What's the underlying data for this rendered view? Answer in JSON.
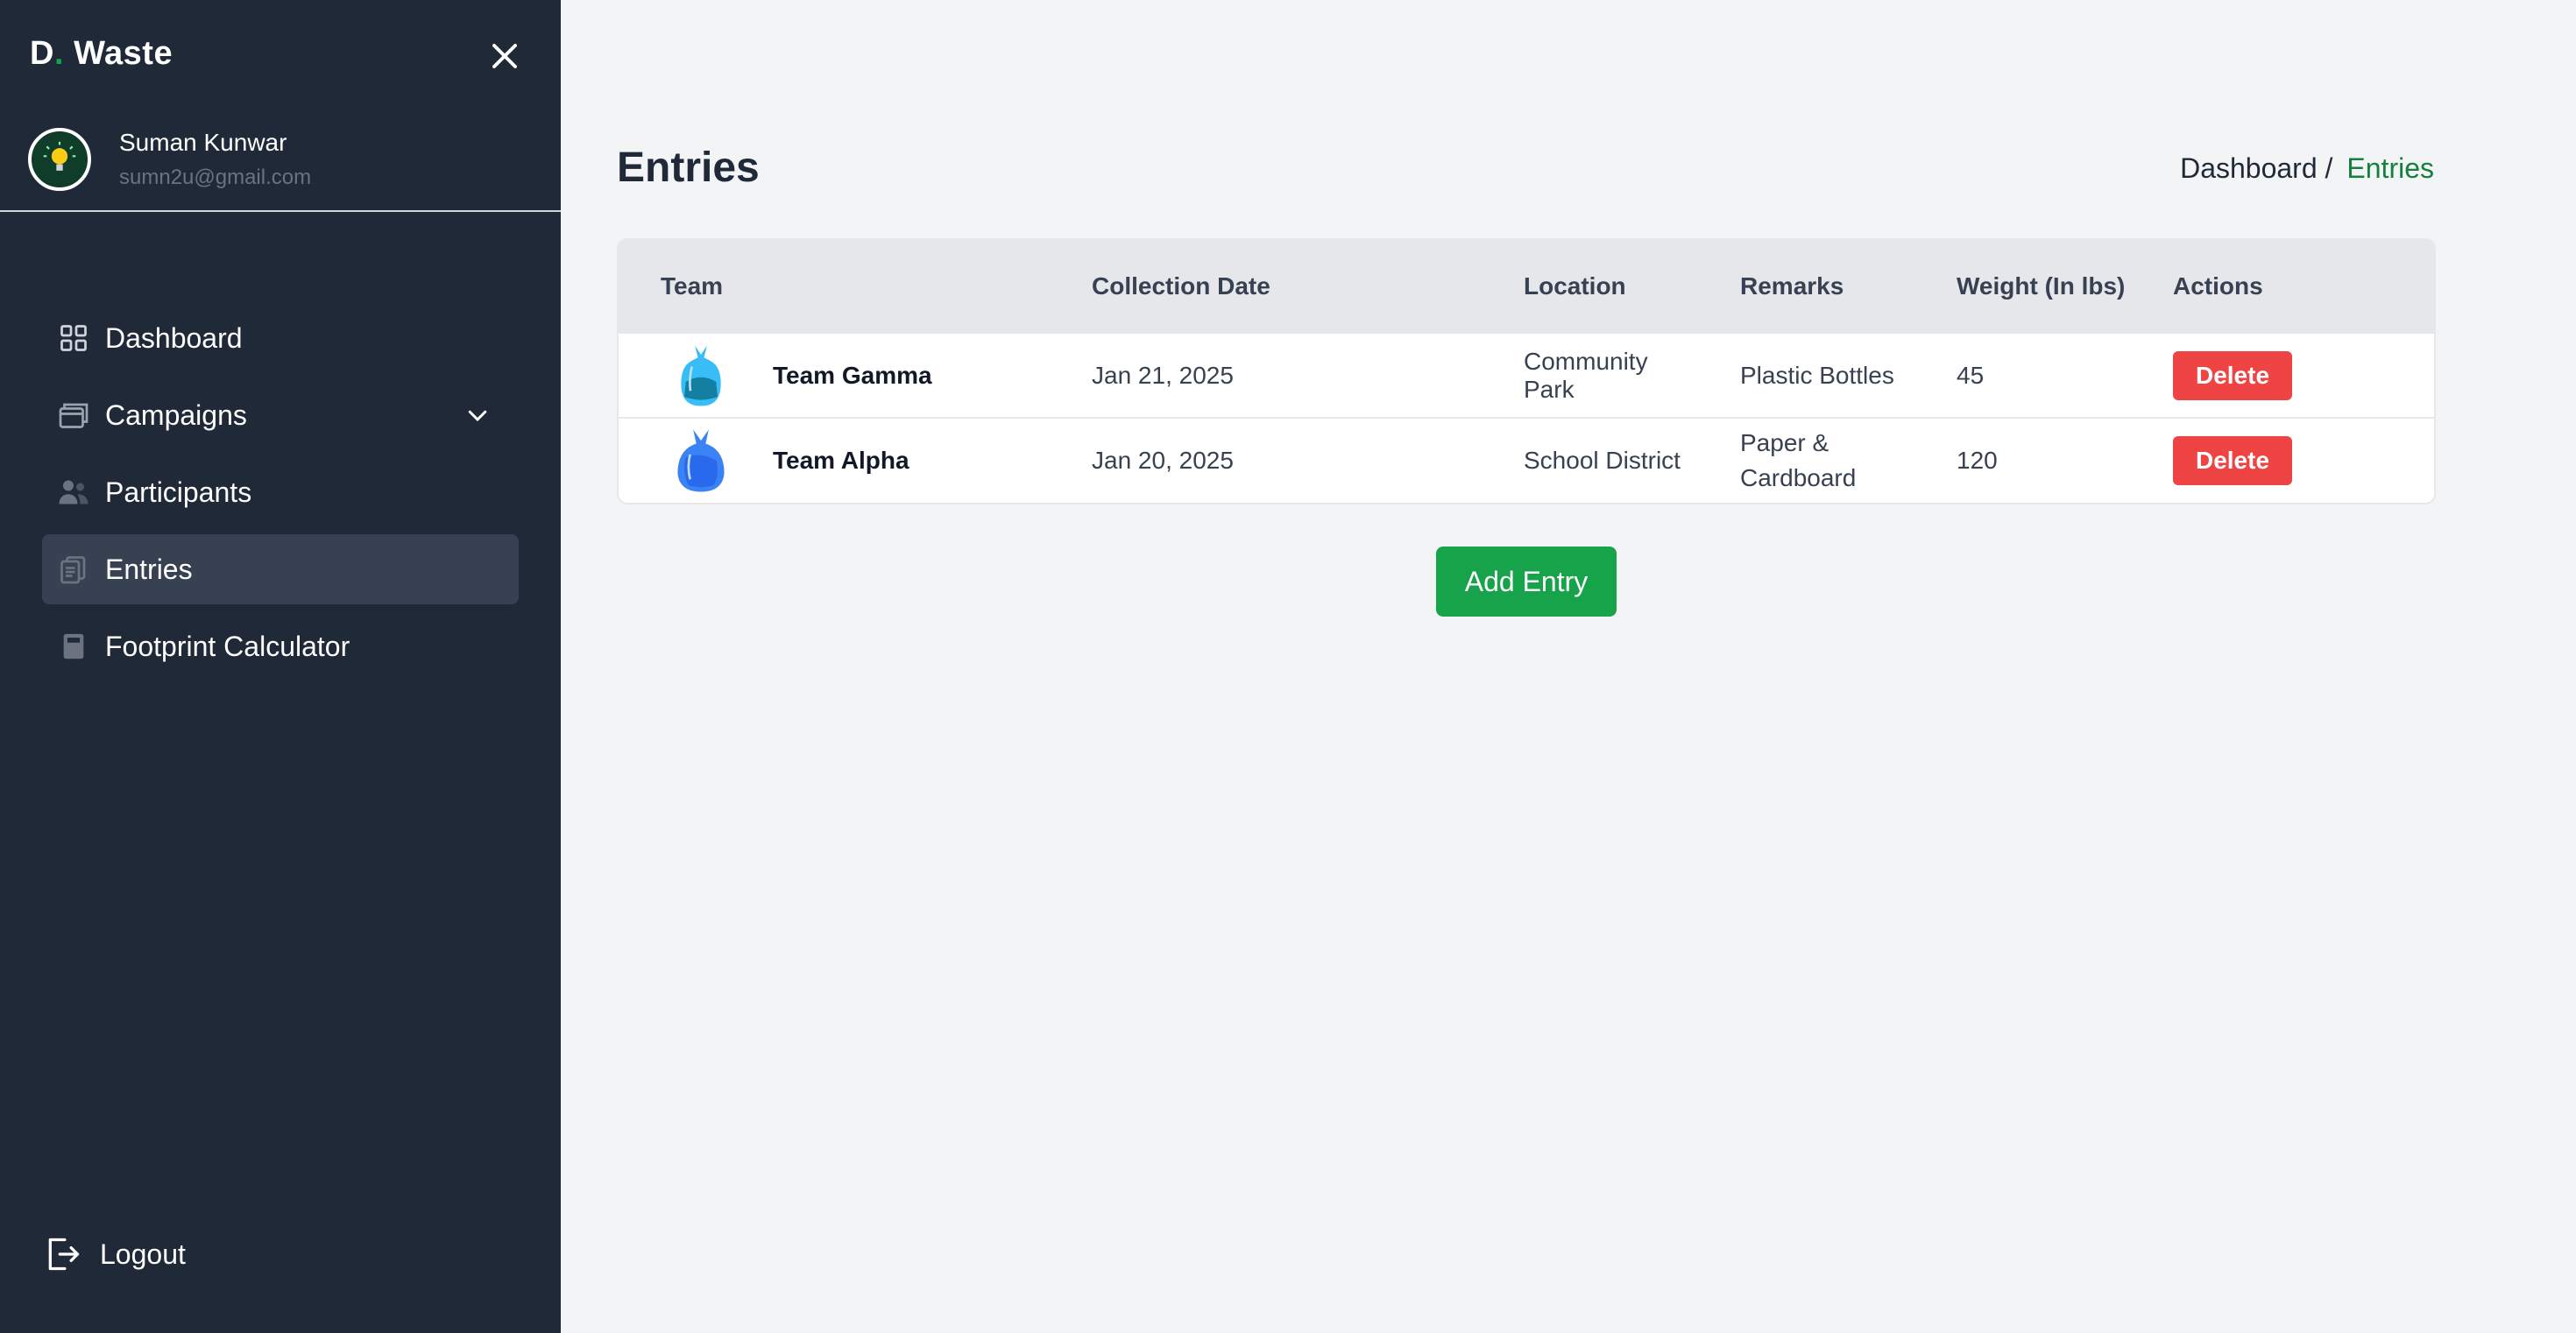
{
  "sidebar": {
    "brand": {
      "prefix": "D",
      "dot": ".",
      "name": " Waste"
    },
    "user": {
      "name": "Suman Kunwar",
      "email": "sumn2u@gmail.com"
    },
    "nav": [
      {
        "label": "Dashboard",
        "icon": "grid-icon"
      },
      {
        "label": "Campaigns",
        "icon": "campaigns-icon"
      },
      {
        "label": "Participants",
        "icon": "users-icon"
      },
      {
        "label": "Entries",
        "icon": "clipboard-icon"
      },
      {
        "label": "Footprint Calculator",
        "icon": "calculator-icon"
      }
    ],
    "logout_label": "Logout"
  },
  "main": {
    "title": "Entries",
    "breadcrumb": {
      "home": "Dashboard /",
      "current": "Entries"
    },
    "table": {
      "headers": [
        "Team",
        "Collection Date",
        "Location",
        "Remarks",
        "Weight (In lbs)",
        "Actions"
      ],
      "rows": [
        {
          "team": "Team Gamma",
          "date": "Jan 21, 2025",
          "location": "Community Park",
          "remarks": "Plastic Bottles",
          "weight": "45",
          "action": "Delete"
        },
        {
          "team": "Team Alpha",
          "date": "Jan 20, 2025",
          "location": "School District",
          "remarks": "Paper & Cardboard",
          "weight": "120",
          "action": "Delete"
        }
      ]
    },
    "add_entry_label": "Add Entry"
  },
  "colors": {
    "sidebar_bg": "#1f2937",
    "accent": "#16a34a",
    "danger": "#ef4444",
    "page_bg": "#f3f4f6"
  }
}
